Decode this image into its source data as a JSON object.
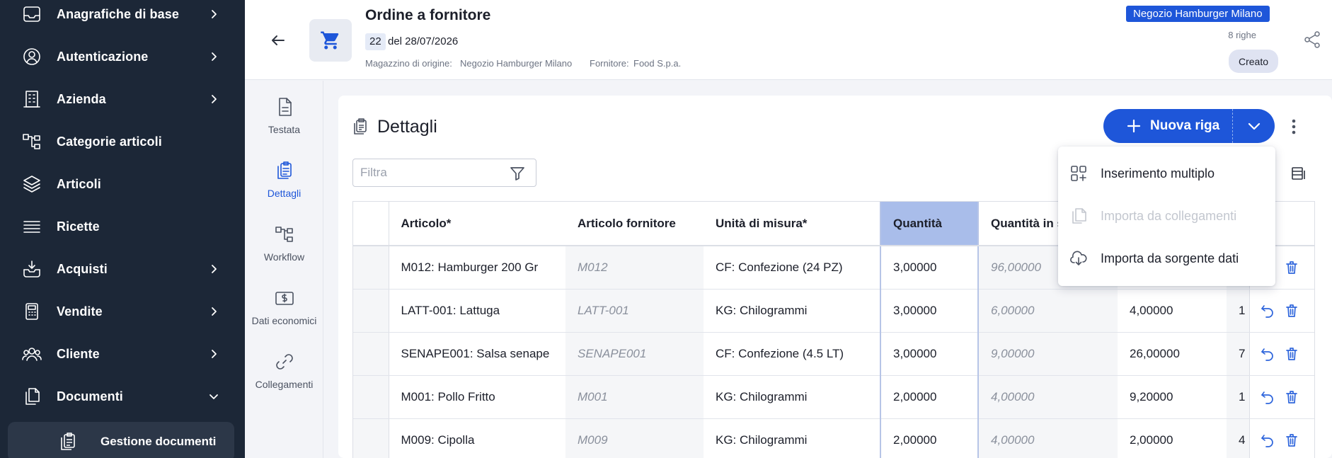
{
  "sidebar": {
    "items": [
      {
        "label": "Anagrafiche di base",
        "icon": "inbox-icon",
        "expandable": true
      },
      {
        "label": "Autenticazione",
        "icon": "user-circle-icon",
        "expandable": true
      },
      {
        "label": "Azienda",
        "icon": "building-icon",
        "expandable": true
      },
      {
        "label": "Categorie articoli",
        "icon": "hierarchy-icon",
        "expandable": false
      },
      {
        "label": "Articoli",
        "icon": "layers-icon",
        "expandable": false
      },
      {
        "label": "Ricette",
        "icon": "list-lines-icon",
        "expandable": false
      },
      {
        "label": "Acquisti",
        "icon": "tray-download-icon",
        "expandable": true
      },
      {
        "label": "Vendite",
        "icon": "calculator-icon",
        "expandable": true
      },
      {
        "label": "Cliente",
        "icon": "users-icon",
        "expandable": true
      },
      {
        "label": "Documenti",
        "icon": "documents-icon",
        "expandable": true,
        "expanded": true
      }
    ],
    "sub_item": {
      "label": "Gestione documenti",
      "icon": "clipboard-copy-icon"
    }
  },
  "header": {
    "title": "Ordine a fornitore",
    "number": "22",
    "date_text": "del 28/07/2026",
    "source_label": "Magazzino di origine:",
    "source_value": "Negozio Hamburger Milano",
    "supplier_label": "Fornitore:",
    "supplier_value": "Food S.p.a.",
    "store_badge": "Negozio Hamburger Milano",
    "rows_count": "8 righe",
    "status": "Creato",
    "accent_color": "#1e56d9"
  },
  "rail": {
    "items": [
      {
        "label": "Testata",
        "icon": "document-icon",
        "active": false
      },
      {
        "label": "Dettagli",
        "icon": "clipboard-copy-icon",
        "active": true
      },
      {
        "label": "Workflow",
        "icon": "workflow-icon",
        "active": false
      },
      {
        "label": "Dati economici",
        "icon": "money-icon",
        "active": false
      },
      {
        "label": "Collegamenti",
        "icon": "link-icon",
        "active": false
      }
    ]
  },
  "details": {
    "title": "Dettagli",
    "filter_placeholder": "Filtra",
    "new_row_label": "Nuova riga",
    "columns": [
      "Articolo*",
      "Articolo fornitore",
      "Unità di misura*",
      "Quantità",
      "Quantità in s"
    ],
    "rows": [
      {
        "article": "M012: Hamburger 200 Gr",
        "supplier_article": "M012",
        "unit": "CF: Confezione (24 PZ)",
        "qty": "3,00000",
        "qty_stock": "96,00000",
        "col6": "",
        "col7": ""
      },
      {
        "article": "LATT-001: Lattuga",
        "supplier_article": "LATT-001",
        "unit": "KG: Chilogrammi",
        "qty": "3,00000",
        "qty_stock": "6,00000",
        "col6": "4,00000",
        "col7": "1"
      },
      {
        "article": "SENAPE001: Salsa senape",
        "supplier_article": "SENAPE001",
        "unit": "CF: Confezione (4.5 LT)",
        "qty": "3,00000",
        "qty_stock": "9,00000",
        "col6": "26,00000",
        "col7": "7"
      },
      {
        "article": "M001: Pollo Fritto",
        "supplier_article": "M001",
        "unit": "KG: Chilogrammi",
        "qty": "2,00000",
        "qty_stock": "4,00000",
        "col6": "9,20000",
        "col7": "1"
      },
      {
        "article": "M009: Cipolla",
        "supplier_article": "M009",
        "unit": "KG: Chilogrammi",
        "qty": "2,00000",
        "qty_stock": "4,00000",
        "col6": "2,00000",
        "col7": "4"
      }
    ]
  },
  "menu": {
    "items": [
      {
        "label": "Inserimento multiplo",
        "icon": "grid-add-icon",
        "disabled": false
      },
      {
        "label": "Importa da collegamenti",
        "icon": "copy-icon",
        "disabled": true
      },
      {
        "label": "Importa da sorgente dati",
        "icon": "cloud-download-icon",
        "disabled": false
      }
    ]
  }
}
